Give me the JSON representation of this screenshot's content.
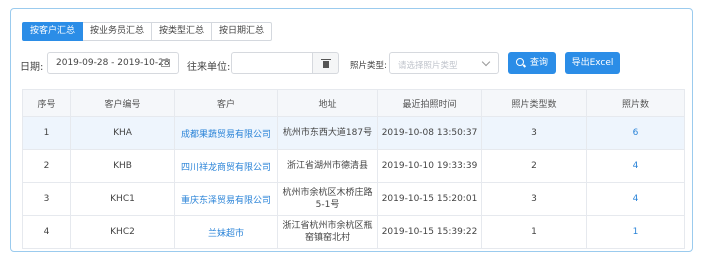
{
  "tabs": [
    {
      "label": "按客户汇总",
      "active": true
    },
    {
      "label": "按业务员汇总",
      "active": false
    },
    {
      "label": "按类型汇总",
      "active": false
    },
    {
      "label": "按日期汇总",
      "active": false
    }
  ],
  "filters": {
    "date_label": "日期:",
    "date_range": "2019-09-28 - 2019-10-28",
    "partner_label": "往来单位:",
    "partner_value": "",
    "photo_type_label": "照片类型:",
    "photo_type_placeholder": "请选择照片类型",
    "search_button": "查询",
    "export_button": "导出Excel"
  },
  "table": {
    "headers": [
      "序号",
      "客户编号",
      "客户",
      "地址",
      "最近拍照时间",
      "照片类型数",
      "照片数"
    ],
    "rows": [
      {
        "no": "1",
        "code": "KHA",
        "customer": "成都果蔬贸易有限公司",
        "address": "杭州市东西大道187号",
        "last_photo": "2019-10-08 13:50:37",
        "type_count": "3",
        "photo_count": "6"
      },
      {
        "no": "2",
        "code": "KHB",
        "customer": "四川祥龙商贸有限公司",
        "address": "浙江省湖州市德清县",
        "last_photo": "2019-10-10 19:33:39",
        "type_count": "2",
        "photo_count": "4"
      },
      {
        "no": "3",
        "code": "KHC1",
        "customer": "重庆东泽贸易有限公司",
        "address": "杭州市余杭区木桥庄路5-1号",
        "last_photo": "2019-10-15 15:20:01",
        "type_count": "3",
        "photo_count": "4"
      },
      {
        "no": "4",
        "code": "KHC2",
        "customer": "兰妹超市",
        "address": "浙江省杭州市余杭区瓶窑镇窑北村",
        "last_photo": "2019-10-15 15:39:22",
        "type_count": "1",
        "photo_count": "1"
      }
    ]
  },
  "colors": {
    "accent": "#2b8de7",
    "link": "#2b84d8",
    "frame_border": "#9bcbee"
  },
  "icons": {
    "date": "calendar-icon",
    "clear": "trash-icon",
    "select": "chevron-down-icon",
    "search": "search-icon"
  }
}
